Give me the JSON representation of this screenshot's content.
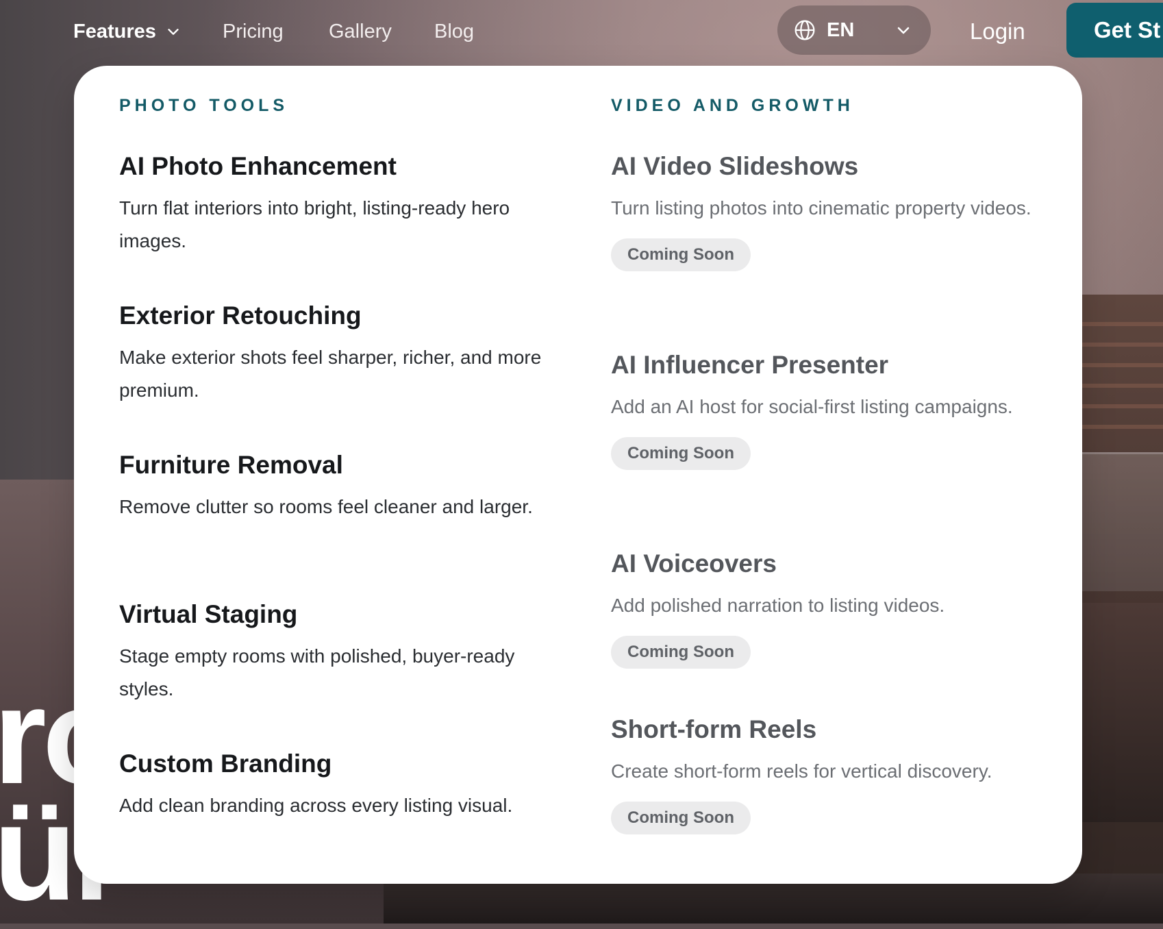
{
  "nav": {
    "features_label": "Features",
    "pricing_label": "Pricing",
    "gallery_label": "Gallery",
    "blog_label": "Blog",
    "language_code": "EN",
    "login_label": "Login",
    "cta_label": "Get St"
  },
  "hero": {
    "partial_text": "ro\nür"
  },
  "dropdown": {
    "photo_tools": {
      "heading": "PHOTO TOOLS",
      "items": [
        {
          "title": "AI Photo Enhancement",
          "desc": "Turn flat interiors into bright, listing-ready hero images."
        },
        {
          "title": "Exterior Retouching",
          "desc": "Make exterior shots feel sharper, richer, and more premium."
        },
        {
          "title": "Furniture Removal",
          "desc": "Remove clutter so rooms feel cleaner and larger."
        },
        {
          "title": "Virtual Staging",
          "desc": "Stage empty rooms with polished, buyer-ready styles."
        },
        {
          "title": "Custom Branding",
          "desc": "Add clean branding across every listing visual."
        }
      ]
    },
    "video_growth": {
      "heading": "VIDEO AND GROWTH",
      "items": [
        {
          "title": "AI Video Slideshows",
          "desc": "Turn listing photos into cinematic property videos.",
          "badge": "Coming Soon"
        },
        {
          "title": "AI Influencer Presenter",
          "desc": "Add an AI host for social-first listing campaigns.",
          "badge": "Coming Soon"
        },
        {
          "title": "AI Voiceovers",
          "desc": "Add polished narration to listing videos.",
          "badge": "Coming Soon"
        },
        {
          "title": "Short-form Reels",
          "desc": "Create short-form reels for vertical discovery.",
          "badge": "Coming Soon"
        }
      ]
    }
  },
  "colors": {
    "accent": "#135a66",
    "cta_bg": "#0f5f6e",
    "badge_bg": "#ebebec"
  },
  "icons": [
    "chevron-down-icon",
    "globe-icon"
  ]
}
